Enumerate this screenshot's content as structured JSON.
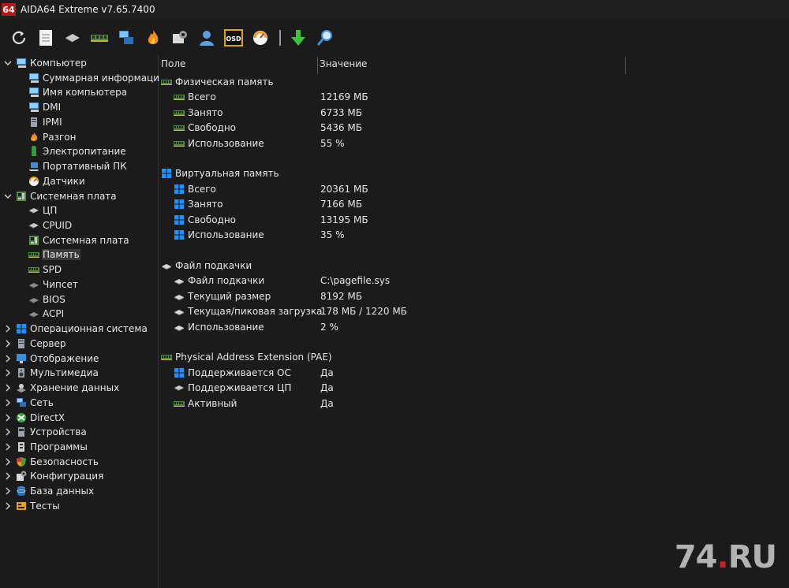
{
  "window": {
    "badge": "64",
    "title": "AIDA64 Extreme v7.65.7400"
  },
  "toolbar": {
    "buttons": [
      "refresh-icon",
      "report-icon",
      "motherboard-icon",
      "memory-icon",
      "network-icon",
      "flame-icon",
      "config-icon",
      "user-icon",
      "osd-icon",
      "gauge-icon",
      "download-icon",
      "search-icon"
    ],
    "osd_label": "OSD"
  },
  "sidebar": {
    "items": [
      {
        "label": "Компьютер",
        "level": 0,
        "expander": "open",
        "icon": "computer-icon"
      },
      {
        "label": "Суммарная информация",
        "level": 1,
        "icon": "computer-icon"
      },
      {
        "label": "Имя компьютера",
        "level": 1,
        "icon": "computer-icon"
      },
      {
        "label": "DMI",
        "level": 1,
        "icon": "computer-icon"
      },
      {
        "label": "IPMI",
        "level": 1,
        "icon": "server-icon"
      },
      {
        "label": "Разгон",
        "level": 1,
        "icon": "flame-icon"
      },
      {
        "label": "Электропитание",
        "level": 1,
        "icon": "battery-icon"
      },
      {
        "label": "Портативный ПК",
        "level": 1,
        "icon": "laptop-icon"
      },
      {
        "label": "Датчики",
        "level": 1,
        "icon": "gauge-icon"
      },
      {
        "label": "Системная плата",
        "level": 0,
        "expander": "open",
        "icon": "motherboard-icon"
      },
      {
        "label": "ЦП",
        "level": 1,
        "icon": "cpu-icon"
      },
      {
        "label": "CPUID",
        "level": 1,
        "icon": "cpu-icon"
      },
      {
        "label": "Системная плата",
        "level": 1,
        "icon": "motherboard-icon"
      },
      {
        "label": "Память",
        "level": 1,
        "icon": "memory-icon",
        "selected": true
      },
      {
        "label": "SPD",
        "level": 1,
        "icon": "memory-icon"
      },
      {
        "label": "Чипсет",
        "level": 1,
        "icon": "chip-icon"
      },
      {
        "label": "BIOS",
        "level": 1,
        "icon": "chip-icon"
      },
      {
        "label": "ACPI",
        "level": 1,
        "icon": "chip-icon"
      },
      {
        "label": "Операционная система",
        "level": 0,
        "expander": "closed",
        "icon": "windows-icon"
      },
      {
        "label": "Сервер",
        "level": 0,
        "expander": "closed",
        "icon": "server-icon"
      },
      {
        "label": "Отображение",
        "level": 0,
        "expander": "closed",
        "icon": "display-icon"
      },
      {
        "label": "Мультимедиа",
        "level": 0,
        "expander": "closed",
        "icon": "speaker-icon"
      },
      {
        "label": "Хранение данных",
        "level": 0,
        "expander": "closed",
        "icon": "storage-icon"
      },
      {
        "label": "Сеть",
        "level": 0,
        "expander": "closed",
        "icon": "network-icon"
      },
      {
        "label": "DirectX",
        "level": 0,
        "expander": "closed",
        "icon": "xbox-icon"
      },
      {
        "label": "Устройства",
        "level": 0,
        "expander": "closed",
        "icon": "devices-icon"
      },
      {
        "label": "Программы",
        "level": 0,
        "expander": "closed",
        "icon": "programs-icon"
      },
      {
        "label": "Безопасность",
        "level": 0,
        "expander": "closed",
        "icon": "shield-icon"
      },
      {
        "label": "Конфигурация",
        "level": 0,
        "expander": "closed",
        "icon": "config-icon"
      },
      {
        "label": "База данных",
        "level": 0,
        "expander": "closed",
        "icon": "database-icon"
      },
      {
        "label": "Тесты",
        "level": 0,
        "expander": "closed",
        "icon": "tests-icon"
      }
    ]
  },
  "table": {
    "headers": [
      "Поле",
      "Значение"
    ],
    "sections": [
      {
        "title": "Физическая память",
        "icon": "memory-icon",
        "rows": [
          {
            "field": "Всего",
            "value": "12169 МБ",
            "icon": "memory-icon"
          },
          {
            "field": "Занято",
            "value": "6733 МБ",
            "icon": "memory-icon"
          },
          {
            "field": "Свободно",
            "value": "5436 МБ",
            "icon": "memory-icon"
          },
          {
            "field": "Использование",
            "value": "55 %",
            "icon": "memory-icon"
          }
        ]
      },
      {
        "title": "Виртуальная память",
        "icon": "windows-icon",
        "rows": [
          {
            "field": "Всего",
            "value": "20361 МБ",
            "icon": "windows-icon"
          },
          {
            "field": "Занято",
            "value": "7166 МБ",
            "icon": "windows-icon"
          },
          {
            "field": "Свободно",
            "value": "13195 МБ",
            "icon": "windows-icon"
          },
          {
            "field": "Использование",
            "value": "35 %",
            "icon": "windows-icon"
          }
        ]
      },
      {
        "title": "Файл подкачки",
        "icon": "disk-icon",
        "rows": [
          {
            "field": "Файл подкачки",
            "value": "C:\\pagefile.sys",
            "icon": "disk-icon"
          },
          {
            "field": "Текущий размер",
            "value": "8192 МБ",
            "icon": "disk-icon"
          },
          {
            "field": "Текущая/пиковая загрузка",
            "value": "178 МБ / 1220 МБ",
            "icon": "disk-icon"
          },
          {
            "field": "Использование",
            "value": "2 %",
            "icon": "disk-icon"
          }
        ]
      },
      {
        "title": "Physical Address Extension (PAE)",
        "icon": "memory-icon",
        "rows": [
          {
            "field": "Поддерживается ОС",
            "value": "Да",
            "icon": "windows-icon"
          },
          {
            "field": "Поддерживается ЦП",
            "value": "Да",
            "icon": "cpu-icon"
          },
          {
            "field": "Активный",
            "value": "Да",
            "icon": "memory-icon"
          }
        ]
      }
    ]
  },
  "watermark": {
    "main": "74",
    "dot": ".",
    "suffix": "RU"
  },
  "colors": {
    "background": "#1b1b1b",
    "selection": "#3a3a3a",
    "badge": "#b01c1c",
    "windows_blue": "#1e90ff",
    "memory_green": "#6aa84f",
    "arrow_green": "#3cc23c"
  }
}
